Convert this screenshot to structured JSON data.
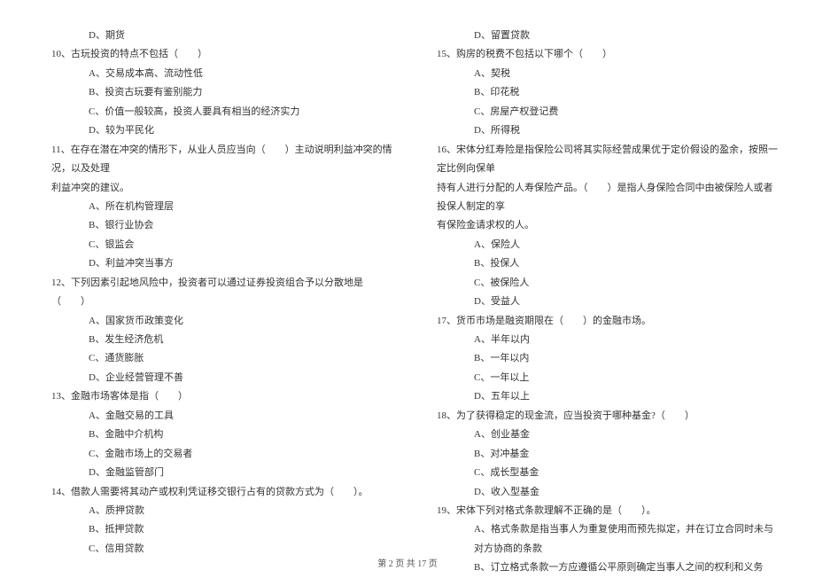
{
  "left": {
    "opt_d_prev": "D、期货",
    "q10": "10、古玩投资的特点不包括（　　）",
    "q10a": "A、交易成本高、流动性低",
    "q10b": "B、投资古玩要有鉴别能力",
    "q10c": "C、价值一般较高，投资人要具有相当的经济实力",
    "q10d": "D、较为平民化",
    "q11": "11、在存在潜在冲突的情形下，从业人员应当向（　　）主动说明利益冲突的情况，以及处理",
    "q11_cont": "利益冲突的建议。",
    "q11a": "A、所在机构管理层",
    "q11b": "B、银行业协会",
    "q11c": "C、银监会",
    "q11d": "D、利益冲突当事方",
    "q12": "12、下列因素引起地风险中，投资者可以通过证券投资组合予以分散地是（　　）",
    "q12a": "A、国家货币政策变化",
    "q12b": "B、发生经济危机",
    "q12c": "C、通货膨胀",
    "q12d": "D、企业经营管理不善",
    "q13": "13、金融市场客体是指（　　）",
    "q13a": "A、金融交易的工具",
    "q13b": "B、金融中介机构",
    "q13c": "C、金融市场上的交易者",
    "q13d": "D、金融监管部门",
    "q14": "14、借款人需要将其动产或权利凭证移交银行占有的贷款方式为（　　）。",
    "q14a": "A、质押贷款",
    "q14b": "B、抵押贷款",
    "q14c": "C、信用贷款"
  },
  "right": {
    "opt_d_prev": "D、留置贷款",
    "q15": "15、购房的税费不包括以下哪个（　　）",
    "q15a": "A、契税",
    "q15b": "B、印花税",
    "q15c": "C、房屋产权登记费",
    "q15d": "D、所得税",
    "q16": "16、宋体分红寿险是指保险公司将其实际经营成果优于定价假设的盈余，按照一定比例向保单",
    "q16_cont1": "持有人进行分配的人寿保险产品。（　　）是指人身保险合同中由被保险人或者投保人制定的享",
    "q16_cont2": "有保险金请求权的人。",
    "q16a": "A、保险人",
    "q16b": "B、投保人",
    "q16c": "C、被保险人",
    "q16d": "D、受益人",
    "q17": "17、货币市场是融资期限在（　　）的金融市场。",
    "q17a": "A、半年以内",
    "q17b": "B、一年以内",
    "q17c": "C、一年以上",
    "q17d": "D、五年以上",
    "q18": "18、为了获得稳定的现金流，应当投资于哪种基金?（　　）",
    "q18a": "A、创业基金",
    "q18b": "B、对冲基金",
    "q18c": "C、成长型基金",
    "q18d": "D、收入型基金",
    "q19": "19、宋体下列对格式条款理解不正确的是（　　）。",
    "q19a": "A、格式条款是指当事人为重复使用而预先拟定，并在订立合同时未与对方协商的条款",
    "q19b": "B、订立格式条款一方应遵循公平原则确定当事人之间的权利和义务"
  },
  "footer": "第 2 页 共 17 页"
}
